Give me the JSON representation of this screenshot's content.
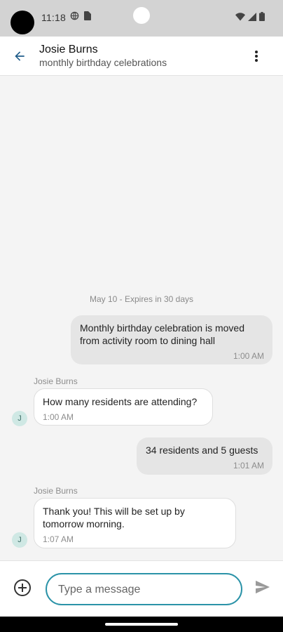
{
  "status_bar": {
    "time": "11:18"
  },
  "header": {
    "title": "Josie Burns",
    "subtitle": "monthly birthday celebrations"
  },
  "conversation": {
    "date_separator": "May 10 - Expires in 30 days",
    "messages": [
      {
        "direction": "outgoing",
        "text": "Monthly birthday celebration is moved from activity room to dining hall",
        "time": "1:00 AM"
      },
      {
        "direction": "incoming",
        "sender": "Josie Burns",
        "avatar_initial": "J",
        "text": "How many residents are attending?",
        "time": "1:00 AM"
      },
      {
        "direction": "outgoing",
        "text": "34 residents and 5 guests",
        "time": "1:01 AM"
      },
      {
        "direction": "incoming",
        "sender": "Josie Burns",
        "avatar_initial": "J",
        "text": "Thank you! This will be set up by tomorrow morning.",
        "time": "1:07 AM"
      }
    ]
  },
  "compose": {
    "placeholder": "Type a message"
  },
  "colors": {
    "accent": "#2b93a8",
    "outgoing_bubble": "#e5e5e5",
    "incoming_bubble": "#ffffff",
    "avatar_bg": "#cfe8e4"
  },
  "icons": {
    "back": "arrow-back-icon",
    "more": "more-vert-icon",
    "add": "add-circle-icon",
    "send": "send-icon"
  }
}
